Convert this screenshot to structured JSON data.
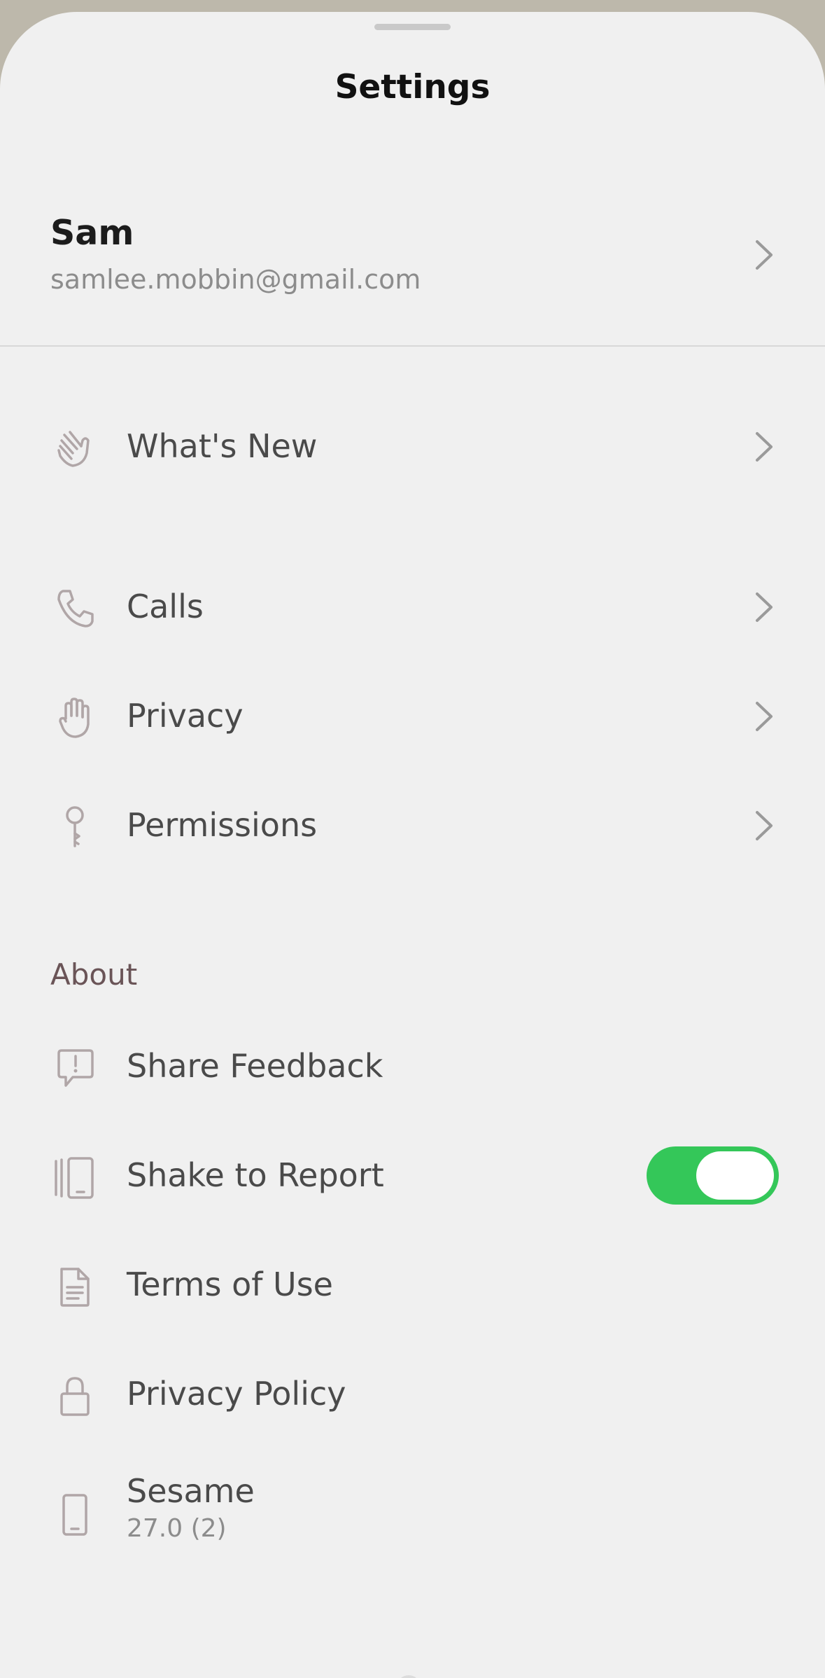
{
  "header": {
    "title": "Settings"
  },
  "account": {
    "name": "Sam",
    "email": "samlee.mobbin@gmail.com"
  },
  "menu": {
    "whats_new": "What's New",
    "calls": "Calls",
    "privacy": "Privacy",
    "permissions": "Permissions"
  },
  "about": {
    "header": "About",
    "share_feedback": "Share Feedback",
    "shake_to_report": "Shake to Report",
    "shake_to_report_enabled": true,
    "terms_of_use": "Terms of Use",
    "privacy_policy": "Privacy Policy",
    "app_name": "Sesame",
    "app_version": "27.0 (2)"
  },
  "colors": {
    "toggle_on": "#34c759",
    "section_header": "#6a5457",
    "icon_stroke": "#b0a6a7"
  },
  "icons": {
    "whats_new": "waving-hand-icon",
    "calls": "phone-icon",
    "privacy": "raised-hand-icon",
    "permissions": "key-icon",
    "share_feedback": "feedback-icon",
    "shake_to_report": "shake-phone-icon",
    "terms_of_use": "document-icon",
    "privacy_policy": "lock-icon",
    "sesame": "phone-device-icon"
  }
}
